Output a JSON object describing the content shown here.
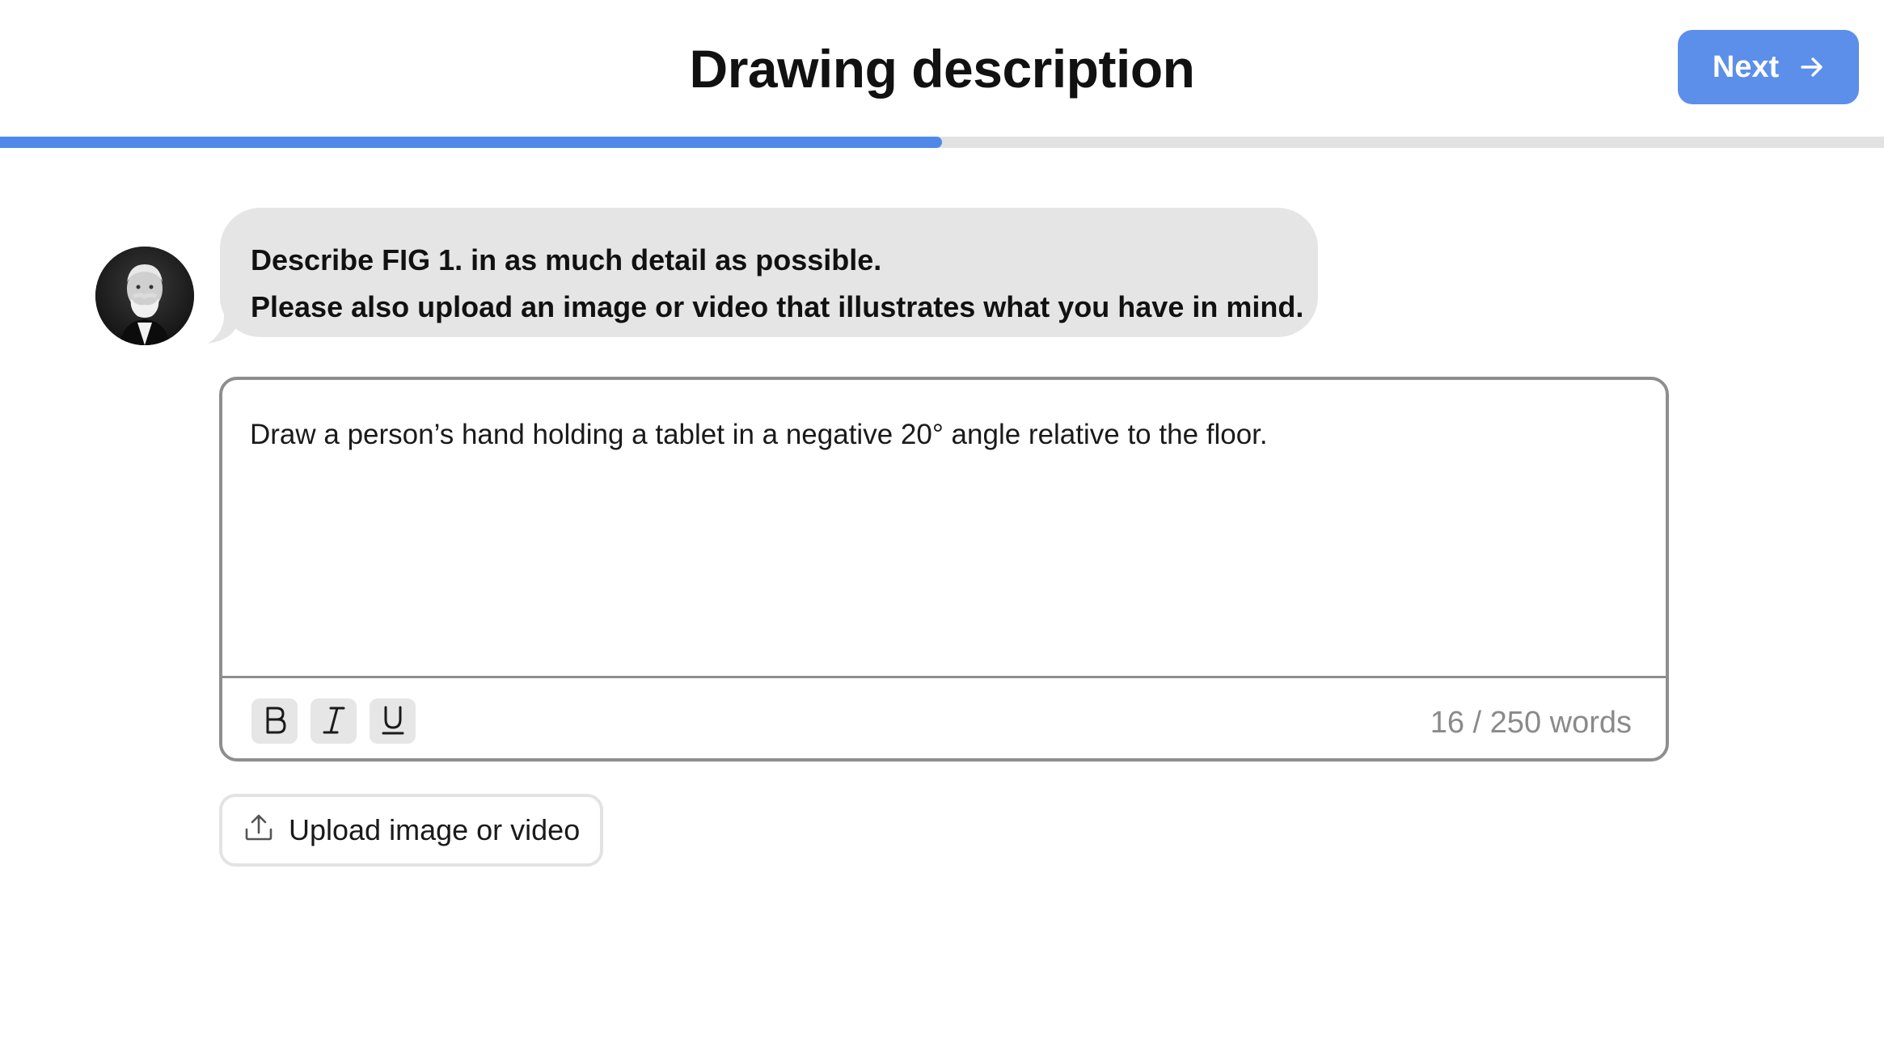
{
  "header": {
    "title": "Drawing description",
    "next_label": "Next",
    "next_icon": "arrow-right-icon",
    "next_color": "#5b8fea"
  },
  "progress": {
    "fraction": 0.5,
    "fill_color": "#4f88e8",
    "track_color": "#e2e2e2"
  },
  "prompt": {
    "avatar_icon": "portrait-avatar",
    "line1": "Describe FIG 1. in as much detail as possible.",
    "line2": "Please also upload an image or video that illustrates what you have in mind."
  },
  "editor": {
    "value": "Draw a person’s hand holding a tablet in a negative 20° angle relative to the floor.",
    "toolbar": {
      "bold_label": "B",
      "italic_label": "I",
      "underline_label": "U"
    },
    "word_count": "16 / 250 words"
  },
  "upload": {
    "label": "Upload image or video",
    "icon": "upload-icon"
  }
}
